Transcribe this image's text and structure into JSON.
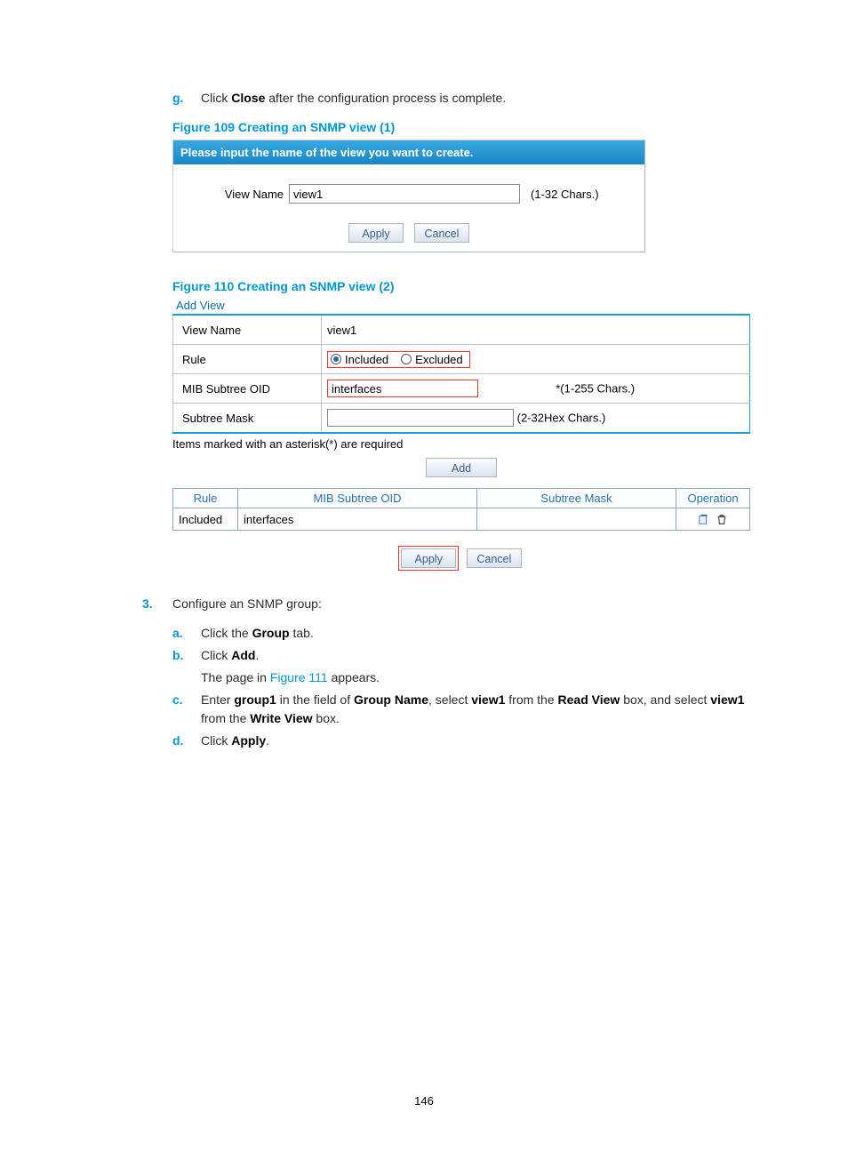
{
  "step_g": {
    "marker": "g.",
    "pre": "Click ",
    "bold": "Close",
    "post": " after the configuration process is complete."
  },
  "fig109": {
    "caption": "Figure 109 Creating an SNMP view (1)",
    "header": "Please input the name of the view you want to create.",
    "label": "View Name",
    "value": "view1",
    "hint": "(1-32 Chars.)",
    "apply": "Apply",
    "cancel": "Cancel"
  },
  "fig110": {
    "caption": "Figure 110 Creating an SNMP view (2)",
    "addview": "Add View",
    "rows": {
      "viewname_label": "View Name",
      "viewname_value": "view1",
      "rule_label": "Rule",
      "rule_included": "Included",
      "rule_excluded": "Excluded",
      "oid_label": "MIB Subtree OID",
      "oid_value": "interfaces",
      "oid_hint": "*(1-255 Chars.)",
      "mask_label": "Subtree Mask",
      "mask_value": "",
      "mask_hint": "(2-32Hex Chars.)"
    },
    "note": "Items marked with an asterisk(*) are required",
    "add": "Add",
    "grid": {
      "headers": [
        "Rule",
        "MIB Subtree OID",
        "Subtree Mask",
        "Operation"
      ],
      "row": [
        "Included",
        "interfaces",
        "",
        ""
      ]
    },
    "apply": "Apply",
    "cancel": "Cancel"
  },
  "step3": {
    "marker": "3.",
    "text": "Configure an SNMP group:",
    "a": {
      "marker": "a.",
      "pre": "Click the ",
      "bold": "Group",
      "post": " tab."
    },
    "b": {
      "marker": "b.",
      "pre": "Click ",
      "bold": "Add",
      "post": ".",
      "extra_pre": "The page in ",
      "extra_link": "Figure 111",
      "extra_post": " appears."
    },
    "c": {
      "marker": "c.",
      "t1": "Enter ",
      "b1": "group1",
      "t2": " in the field of ",
      "b2": "Group Name",
      "t3": ", select ",
      "b3": "view1",
      "t4": " from the ",
      "b4": "Read View",
      "t5": " box, and select ",
      "b5": "view1",
      "t6": " from the ",
      "b6": "Write View",
      "t7": " box."
    },
    "d": {
      "marker": "d.",
      "pre": "Click ",
      "bold": "Apply",
      "post": "."
    }
  },
  "page_number": "146"
}
